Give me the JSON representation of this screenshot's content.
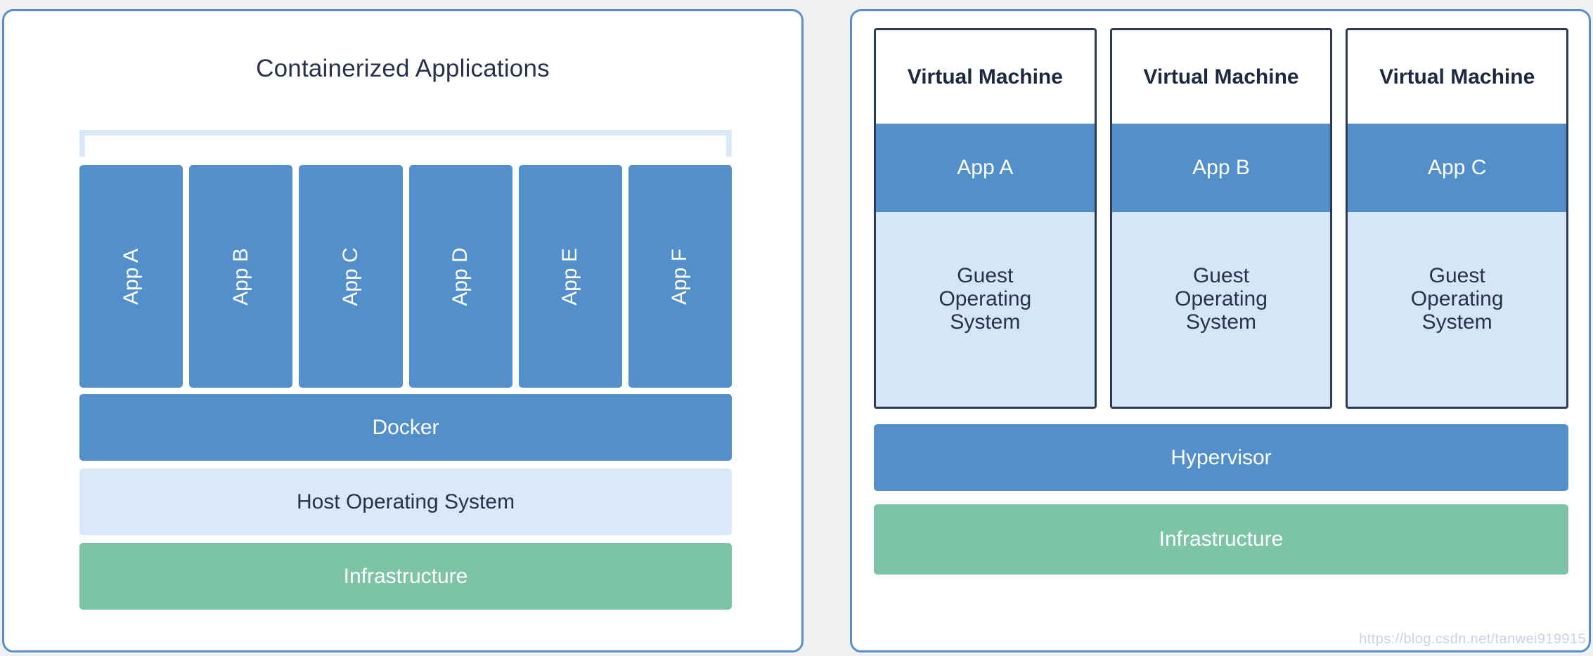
{
  "theme": {
    "page_background": "#eff0f2",
    "panel_border": "#5b8fcc",
    "accent_blue": "#5390cb",
    "light_blue": "#d9e9f8",
    "guest_blue": "#d5e7f7",
    "green": "#7cc3a7",
    "dark_navy": "#29314d",
    "vm_border": "#2d3955"
  },
  "containers_panel": {
    "title": "Containerized Applications",
    "apps": [
      {
        "label": "App A"
      },
      {
        "label": "App B"
      },
      {
        "label": "App C"
      },
      {
        "label": "App D"
      },
      {
        "label": "App E"
      },
      {
        "label": "App F"
      }
    ],
    "layers": [
      {
        "label": "Docker"
      },
      {
        "label": "Host Operating System"
      },
      {
        "label": "Infrastructure"
      }
    ]
  },
  "vms_panel": {
    "vms": [
      {
        "title": "Virtual Machine",
        "app": "App A",
        "guest_lines": [
          "Guest",
          "Operating",
          "System"
        ]
      },
      {
        "title": "Virtual Machine",
        "app": "App B",
        "guest_lines": [
          "Guest",
          "Operating",
          "System"
        ]
      },
      {
        "title": "Virtual Machine",
        "app": "App C",
        "guest_lines": [
          "Guest",
          "Operating",
          "System"
        ]
      }
    ],
    "layers": [
      {
        "label": "Hypervisor"
      },
      {
        "label": "Infrastructure"
      }
    ]
  },
  "watermark": {
    "text": "https://blog.csdn.net/tanwei919915"
  }
}
